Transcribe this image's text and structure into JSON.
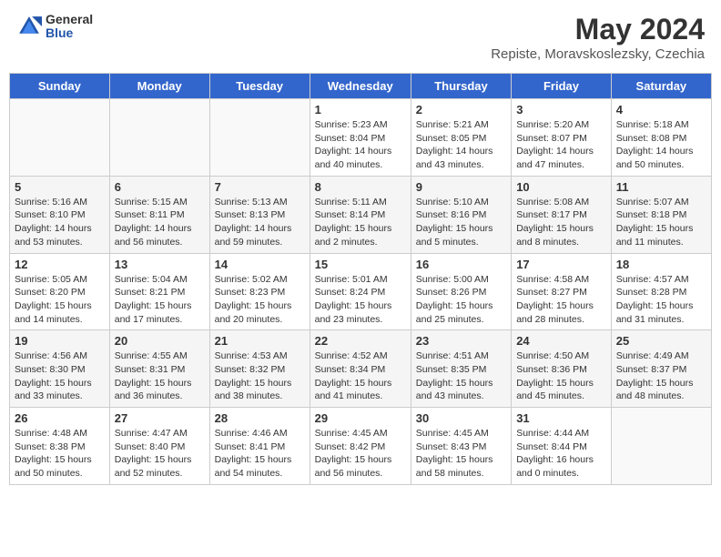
{
  "header": {
    "logo_general": "General",
    "logo_blue": "Blue",
    "title": "May 2024",
    "subtitle": "Repiste, Moravskoslezsky, Czechia"
  },
  "weekdays": [
    "Sunday",
    "Monday",
    "Tuesday",
    "Wednesday",
    "Thursday",
    "Friday",
    "Saturday"
  ],
  "weeks": [
    [
      {
        "day": "",
        "info": ""
      },
      {
        "day": "",
        "info": ""
      },
      {
        "day": "",
        "info": ""
      },
      {
        "day": "1",
        "info": "Sunrise: 5:23 AM\nSunset: 8:04 PM\nDaylight: 14 hours and 40 minutes."
      },
      {
        "day": "2",
        "info": "Sunrise: 5:21 AM\nSunset: 8:05 PM\nDaylight: 14 hours and 43 minutes."
      },
      {
        "day": "3",
        "info": "Sunrise: 5:20 AM\nSunset: 8:07 PM\nDaylight: 14 hours and 47 minutes."
      },
      {
        "day": "4",
        "info": "Sunrise: 5:18 AM\nSunset: 8:08 PM\nDaylight: 14 hours and 50 minutes."
      }
    ],
    [
      {
        "day": "5",
        "info": "Sunrise: 5:16 AM\nSunset: 8:10 PM\nDaylight: 14 hours and 53 minutes."
      },
      {
        "day": "6",
        "info": "Sunrise: 5:15 AM\nSunset: 8:11 PM\nDaylight: 14 hours and 56 minutes."
      },
      {
        "day": "7",
        "info": "Sunrise: 5:13 AM\nSunset: 8:13 PM\nDaylight: 14 hours and 59 minutes."
      },
      {
        "day": "8",
        "info": "Sunrise: 5:11 AM\nSunset: 8:14 PM\nDaylight: 15 hours and 2 minutes."
      },
      {
        "day": "9",
        "info": "Sunrise: 5:10 AM\nSunset: 8:16 PM\nDaylight: 15 hours and 5 minutes."
      },
      {
        "day": "10",
        "info": "Sunrise: 5:08 AM\nSunset: 8:17 PM\nDaylight: 15 hours and 8 minutes."
      },
      {
        "day": "11",
        "info": "Sunrise: 5:07 AM\nSunset: 8:18 PM\nDaylight: 15 hours and 11 minutes."
      }
    ],
    [
      {
        "day": "12",
        "info": "Sunrise: 5:05 AM\nSunset: 8:20 PM\nDaylight: 15 hours and 14 minutes."
      },
      {
        "day": "13",
        "info": "Sunrise: 5:04 AM\nSunset: 8:21 PM\nDaylight: 15 hours and 17 minutes."
      },
      {
        "day": "14",
        "info": "Sunrise: 5:02 AM\nSunset: 8:23 PM\nDaylight: 15 hours and 20 minutes."
      },
      {
        "day": "15",
        "info": "Sunrise: 5:01 AM\nSunset: 8:24 PM\nDaylight: 15 hours and 23 minutes."
      },
      {
        "day": "16",
        "info": "Sunrise: 5:00 AM\nSunset: 8:26 PM\nDaylight: 15 hours and 25 minutes."
      },
      {
        "day": "17",
        "info": "Sunrise: 4:58 AM\nSunset: 8:27 PM\nDaylight: 15 hours and 28 minutes."
      },
      {
        "day": "18",
        "info": "Sunrise: 4:57 AM\nSunset: 8:28 PM\nDaylight: 15 hours and 31 minutes."
      }
    ],
    [
      {
        "day": "19",
        "info": "Sunrise: 4:56 AM\nSunset: 8:30 PM\nDaylight: 15 hours and 33 minutes."
      },
      {
        "day": "20",
        "info": "Sunrise: 4:55 AM\nSunset: 8:31 PM\nDaylight: 15 hours and 36 minutes."
      },
      {
        "day": "21",
        "info": "Sunrise: 4:53 AM\nSunset: 8:32 PM\nDaylight: 15 hours and 38 minutes."
      },
      {
        "day": "22",
        "info": "Sunrise: 4:52 AM\nSunset: 8:34 PM\nDaylight: 15 hours and 41 minutes."
      },
      {
        "day": "23",
        "info": "Sunrise: 4:51 AM\nSunset: 8:35 PM\nDaylight: 15 hours and 43 minutes."
      },
      {
        "day": "24",
        "info": "Sunrise: 4:50 AM\nSunset: 8:36 PM\nDaylight: 15 hours and 45 minutes."
      },
      {
        "day": "25",
        "info": "Sunrise: 4:49 AM\nSunset: 8:37 PM\nDaylight: 15 hours and 48 minutes."
      }
    ],
    [
      {
        "day": "26",
        "info": "Sunrise: 4:48 AM\nSunset: 8:38 PM\nDaylight: 15 hours and 50 minutes."
      },
      {
        "day": "27",
        "info": "Sunrise: 4:47 AM\nSunset: 8:40 PM\nDaylight: 15 hours and 52 minutes."
      },
      {
        "day": "28",
        "info": "Sunrise: 4:46 AM\nSunset: 8:41 PM\nDaylight: 15 hours and 54 minutes."
      },
      {
        "day": "29",
        "info": "Sunrise: 4:45 AM\nSunset: 8:42 PM\nDaylight: 15 hours and 56 minutes."
      },
      {
        "day": "30",
        "info": "Sunrise: 4:45 AM\nSunset: 8:43 PM\nDaylight: 15 hours and 58 minutes."
      },
      {
        "day": "31",
        "info": "Sunrise: 4:44 AM\nSunset: 8:44 PM\nDaylight: 16 hours and 0 minutes."
      },
      {
        "day": "",
        "info": ""
      }
    ]
  ]
}
